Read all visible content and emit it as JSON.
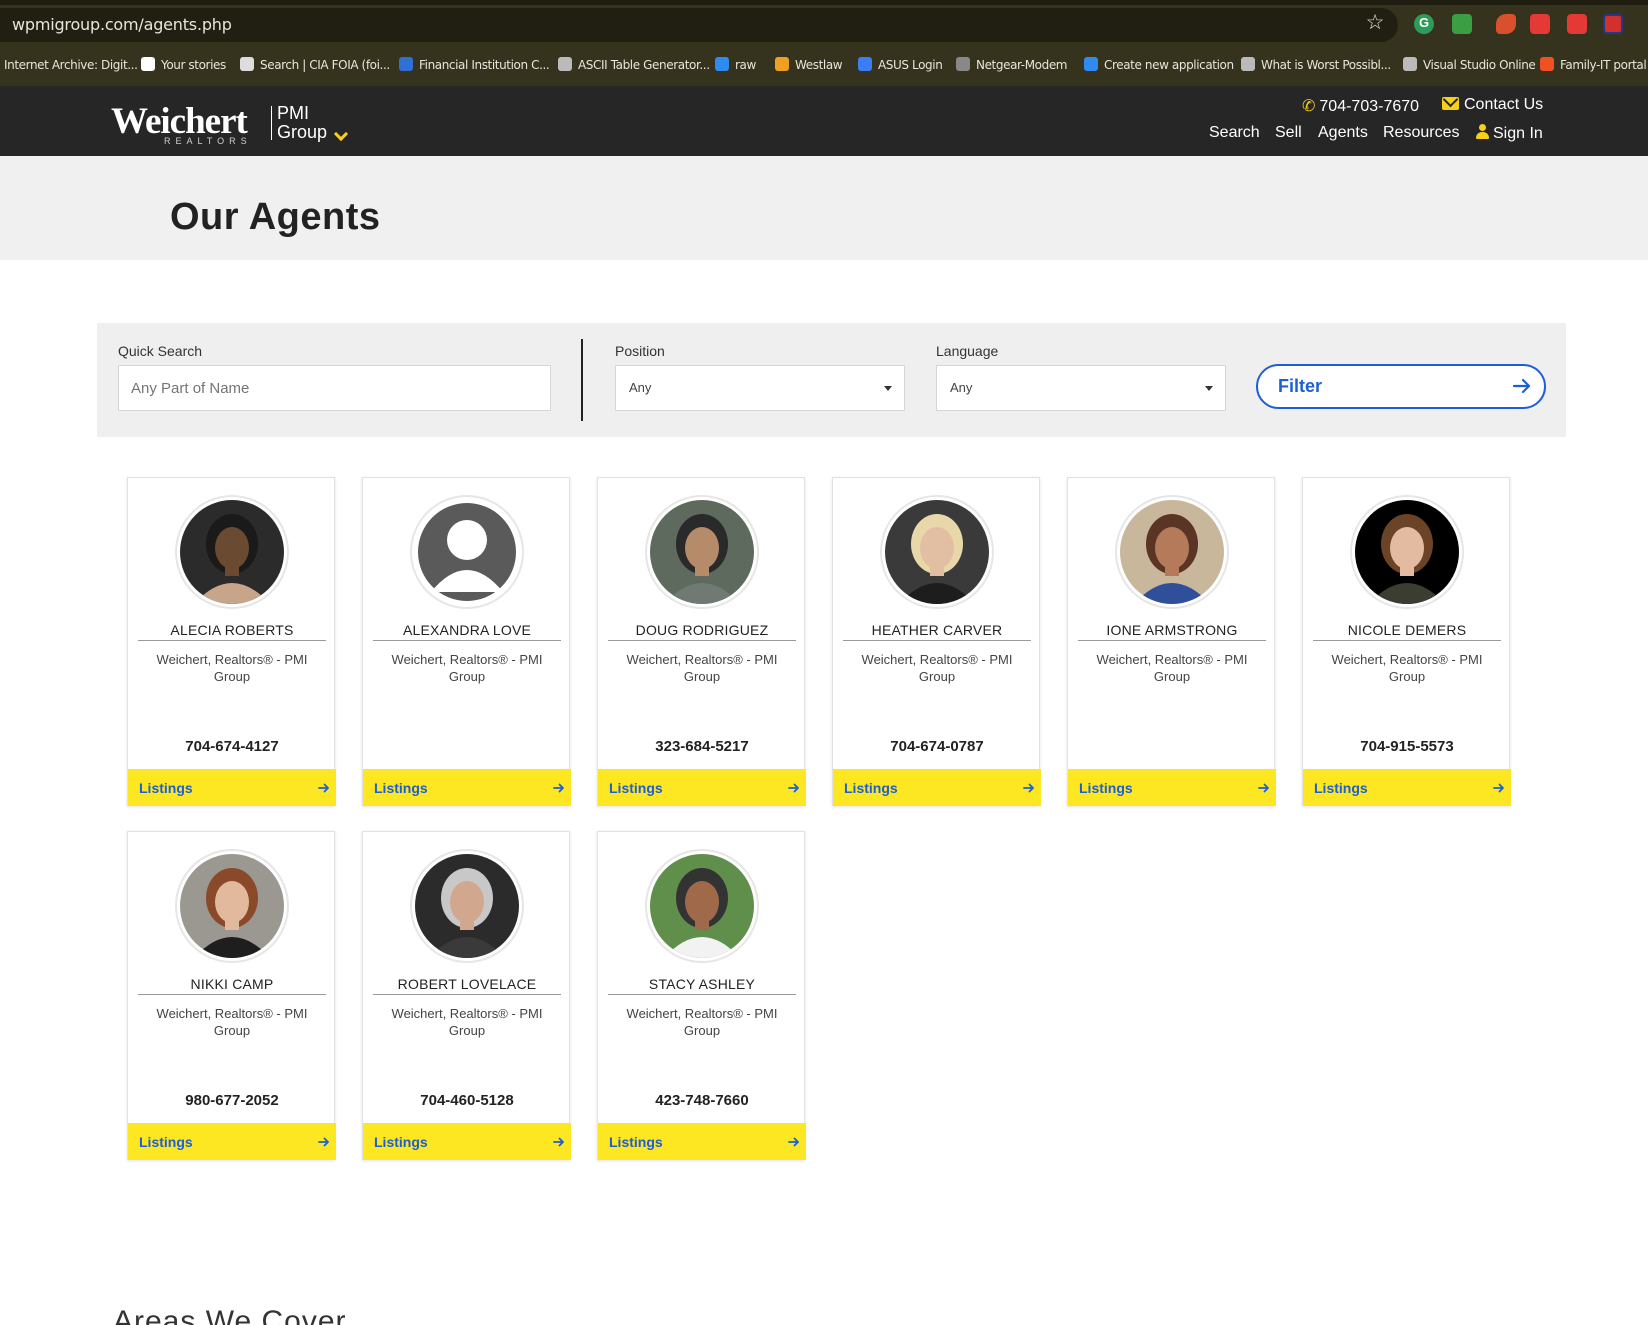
{
  "browser": {
    "url": "wpmigroup.com/agents.php",
    "bookmarks": [
      {
        "label": "Internet Archive: Digit...",
        "icon": "archive-icon",
        "color": "#35321d"
      },
      {
        "label": "Your stories",
        "icon": "medium-icon",
        "color": "#ffffff"
      },
      {
        "label": "Search | CIA FOIA (foi...",
        "icon": "cia-icon",
        "color": "#dddddd"
      },
      {
        "label": "Financial Institution C...",
        "icon": "fdic-icon",
        "color": "#2f6fd6"
      },
      {
        "label": "ASCII Table Generator...",
        "icon": "globe-icon",
        "color": "#bbbbbb"
      },
      {
        "label": "raw",
        "icon": "raw-icon",
        "color": "#2f8bf0"
      },
      {
        "label": "Westlaw",
        "icon": "westlaw-icon",
        "color": "#f0a020"
      },
      {
        "label": "ASUS Login",
        "icon": "asus-icon",
        "color": "#3b7ef2"
      },
      {
        "label": "Netgear-Modem",
        "icon": "tools-icon",
        "color": "#888888"
      },
      {
        "label": "Create new application",
        "icon": "azure-icon",
        "color": "#2f8bf0"
      },
      {
        "label": "What is Worst Possibl...",
        "icon": "globe-icon",
        "color": "#bbbbbb"
      },
      {
        "label": "Visual Studio Online",
        "icon": "globe-icon",
        "color": "#bbbbbb"
      },
      {
        "label": "Family-IT portal",
        "icon": "microsoft-icon",
        "color": "#f25022"
      }
    ]
  },
  "header": {
    "logo_main": "Weichert",
    "logo_sub": "REALTORS",
    "logo_group_line1": "PMI",
    "logo_group_line2": "Group",
    "phone": "704-703-7670",
    "contact": "Contact Us",
    "nav": [
      "Search",
      "Sell",
      "Agents",
      "Resources",
      "Sign In"
    ]
  },
  "page": {
    "title": "Our Agents",
    "areas_heading": "Areas We Cover"
  },
  "filters": {
    "quick_search_label": "Quick Search",
    "quick_search_placeholder": "Any Part of Name",
    "position_label": "Position",
    "position_value": "Any",
    "language_label": "Language",
    "language_value": "Any",
    "filter_button": "Filter"
  },
  "agents": [
    {
      "name": "ALECIA ROBERTS",
      "office": "Weichert, Realtors® - PMI Group",
      "phone": "704-674-4127",
      "listings": "Listings",
      "photo": "photo-woman-dark-hair"
    },
    {
      "name": "ALEXANDRA LOVE",
      "office": "Weichert, Realtors® - PMI Group",
      "phone": "",
      "listings": "Listings",
      "photo": "placeholder-avatar"
    },
    {
      "name": "DOUG RODRIGUEZ",
      "office": "Weichert, Realtors® - PMI Group",
      "phone": "323-684-5217",
      "listings": "Listings",
      "photo": "photo-man-glasses"
    },
    {
      "name": "HEATHER CARVER",
      "office": "Weichert, Realtors® - PMI Group",
      "phone": "704-674-0787",
      "listings": "Listings",
      "photo": "photo-woman-blonde"
    },
    {
      "name": "IONE ARMSTRONG",
      "office": "Weichert, Realtors® - PMI Group",
      "phone": "",
      "listings": "Listings",
      "photo": "photo-woman-curly"
    },
    {
      "name": "NICOLE DEMERS",
      "office": "Weichert, Realtors® - PMI Group",
      "phone": "704-915-5573",
      "listings": "Listings",
      "photo": "photo-woman-brunette"
    },
    {
      "name": "NIKKI CAMP",
      "office": "Weichert, Realtors® - PMI Group",
      "phone": "980-677-2052",
      "listings": "Listings",
      "photo": "photo-woman-auburn"
    },
    {
      "name": "ROBERT LOVELACE",
      "office": "Weichert, Realtors® - PMI Group",
      "phone": "704-460-5128",
      "listings": "Listings",
      "photo": "photo-man-gray-beard"
    },
    {
      "name": "STACY ASHLEY",
      "office": "Weichert, Realtors® - PMI Group",
      "phone": "423-748-7660",
      "listings": "Listings",
      "photo": "photo-woman-outdoor"
    }
  ],
  "colors": {
    "header_bg": "#262626",
    "accent_yellow": "#fde622",
    "link_blue": "#1c5fd6"
  }
}
